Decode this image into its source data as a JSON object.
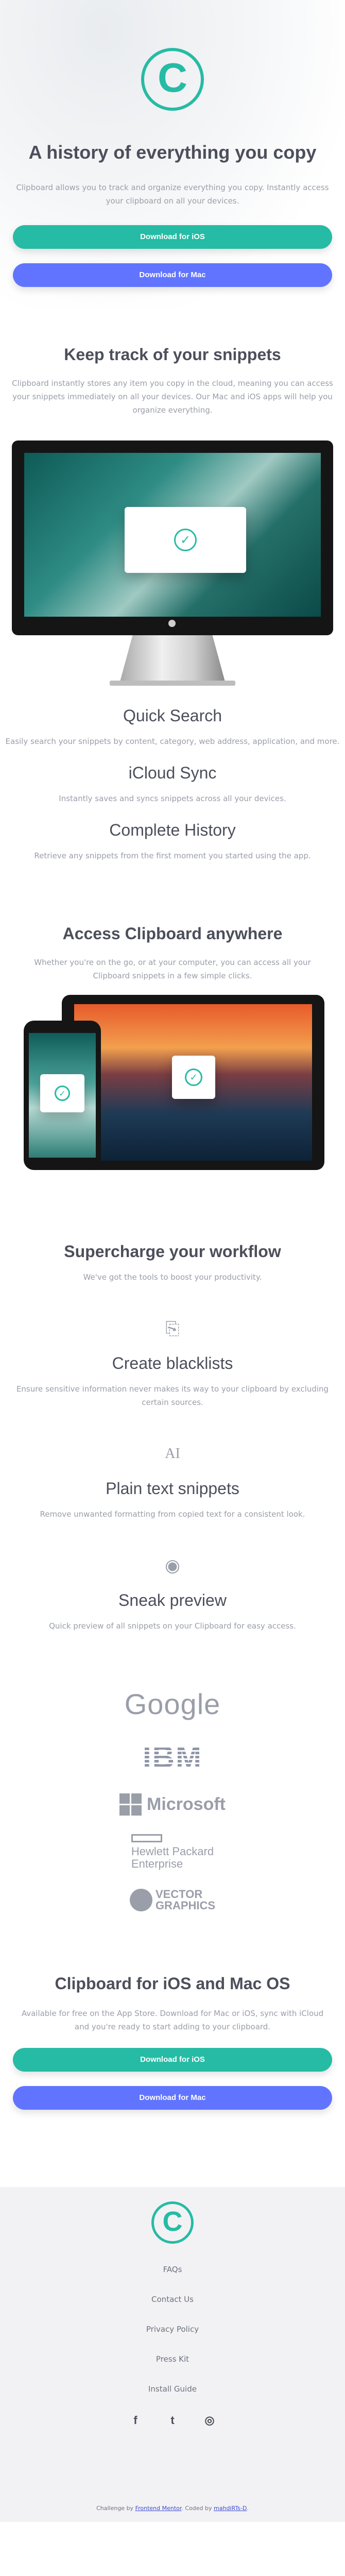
{
  "hero": {
    "logo_letter": "C",
    "title": "A history of everything you copy",
    "description": "Clipboard allows you to track and organize everything you copy. Instantly access your clipboard on all your devices.",
    "ios_button": "Download for iOS",
    "mac_button": "Download for Mac"
  },
  "snippets": {
    "title": "Keep track of your snippets",
    "description": "Clipboard instantly stores any item you copy in the cloud, meaning you can access your snippets immediately on all your devices. Our Mac and iOS apps will help you organize everything.",
    "check_glyph": "✓",
    "features": [
      {
        "title": "Quick Search",
        "text": "Easily search your snippets by content, category, web address, application, and more."
      },
      {
        "title": "iCloud Sync",
        "text": "Instantly saves and syncs snippets across all your devices."
      },
      {
        "title": "Complete History",
        "text": "Retrieve any snippets from the first moment you started using the app."
      }
    ]
  },
  "access": {
    "title": "Access Clipboard anywhere",
    "description": "Whether you're on the go, or at your computer, you can access all your Clipboard snippets in a few simple clicks."
  },
  "workflow": {
    "title": "Supercharge your workflow",
    "subtitle": "We've got the tools to boost your productivity.",
    "items": [
      {
        "icon": "blacklist-icon",
        "glyph": "⎘",
        "title": "Create blacklists",
        "text": "Ensure sensitive information never makes its way to your clipboard by excluding certain sources."
      },
      {
        "icon": "text-icon",
        "glyph": "AI",
        "title": "Plain text snippets",
        "text": "Remove unwanted formatting from copied text for a consistent look."
      },
      {
        "icon": "eye-icon",
        "glyph": "◉",
        "title": "Sneak preview",
        "text": "Quick preview of all snippets on your Clipboard for easy access."
      }
    ]
  },
  "logos": {
    "google": "Google",
    "ibm": "IBM",
    "microsoft": "Microsoft",
    "hpe_line1": "Hewlett Packard",
    "hpe_line2": "Enterprise",
    "vector_line1": "VECTOR",
    "vector_line2": "GRAPHICS"
  },
  "cta": {
    "title": "Clipboard for iOS and Mac OS",
    "description": "Available for free on the App Store. Download for Mac or iOS, sync with iCloud and you're ready to start adding to your clipboard.",
    "ios_button": "Download for iOS",
    "mac_button": "Download for Mac"
  },
  "footer": {
    "logo_letter": "C",
    "links": [
      "FAQs",
      "Contact Us",
      "Privacy Policy",
      "Press Kit",
      "Install Guide"
    ],
    "socials": [
      {
        "icon": "facebook-icon",
        "glyph": "f"
      },
      {
        "icon": "twitter-icon",
        "glyph": "t"
      },
      {
        "icon": "instagram-icon",
        "glyph": "◎"
      }
    ],
    "credit_prefix": "Challenge by ",
    "credit_challenge": "Frontend Mentor",
    "credit_mid": ". Coded by ",
    "credit_author": "mahdiRTs-D",
    "credit_suffix": "."
  },
  "colors": {
    "accent_green": "#26bba4",
    "accent_blue": "#6174ff",
    "heading": "#4c4f5b",
    "body_text": "#9a9ea9"
  }
}
